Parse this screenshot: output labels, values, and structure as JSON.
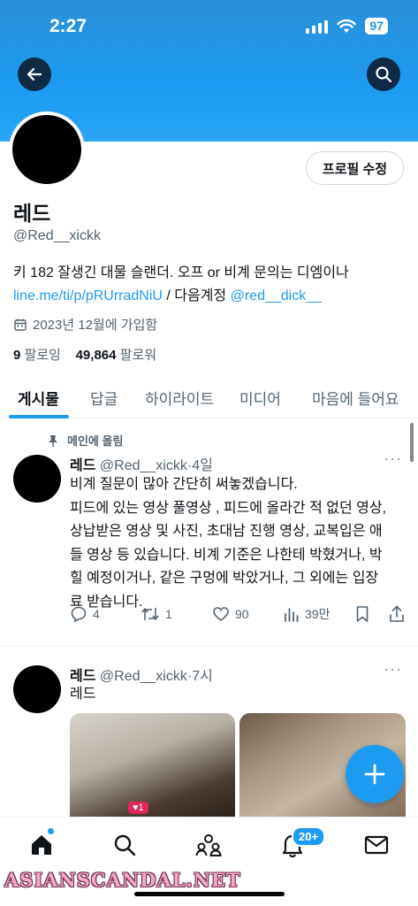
{
  "status_bar": {
    "time": "2:27",
    "battery": "97"
  },
  "profile": {
    "name": "레드",
    "handle": "@Red__xickk",
    "bio_line1": "키 182 잘생긴 대물 슬랜더. 오프 or 비계 문의는 디엠이나",
    "bio_link": "line.me/ti/p/pRUrradNiU",
    "bio_mid": " / 다음계정 ",
    "bio_mention": "@red__dick__",
    "joined": "2023년 12월에 가입함",
    "following_count": "9",
    "following_label": "팔로잉",
    "followers_count": "49,864",
    "followers_label": "팔로워",
    "edit_button": "프로필 수정"
  },
  "tabs": [
    {
      "label": "게시물"
    },
    {
      "label": "답글"
    },
    {
      "label": "하이라이트"
    },
    {
      "label": "미디어"
    },
    {
      "label": "마음에 들어요"
    }
  ],
  "tweets": [
    {
      "pinned_label": "메인에 올림",
      "name": "레드",
      "handle": "@Red__xickk",
      "time": "·4일",
      "lines": [
        "비계 질문이 많아 간단히 써놓겠습니다.",
        "피드에 있는 영상 풀영상 , 피드에 올라간 적 없던 영상,",
        "상납받은 영상 및 사진, 초대남 진행 영상, 교복입은 애",
        "들 영상 등 있습니다. 비계 기준은 나한테 박혔거나, 박",
        "힐 예정이거나, 같은 구멍에 박았거나, 그 외에는 입장",
        "료 받습니다."
      ],
      "replies": "4",
      "retweets": "1",
      "likes": "90",
      "views": "39만"
    },
    {
      "name": "레드",
      "handle": "@Red__xickk",
      "time": "·7시",
      "text": "레드",
      "media_like_badge": "♥1"
    }
  ],
  "bottom_nav": {
    "notifications_badge": "20+"
  },
  "watermark": "ASIANSCANDAL.NET",
  "colors": {
    "accent": "#1d9bf0",
    "text": "#0f1419",
    "muted": "#536471"
  }
}
